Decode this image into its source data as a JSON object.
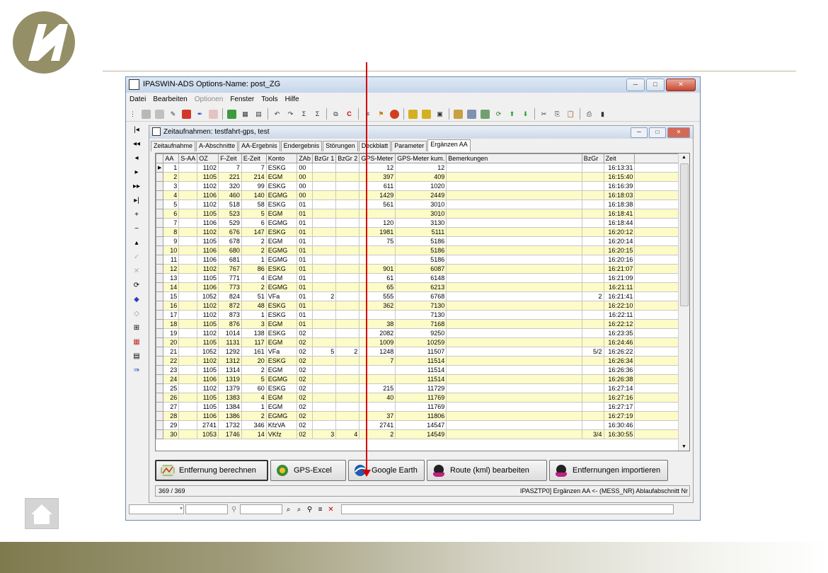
{
  "slide": {
    "logo_name": "company-logo",
    "home_icon": "home-icon"
  },
  "app": {
    "title": "IPASWIN-ADS  Options-Name: post_ZG",
    "menu": [
      "Datei",
      "Bearbeiten",
      "Optionen",
      "Fenster",
      "Tools",
      "Hilfe"
    ],
    "window_buttons": [
      "─",
      "□",
      "✕"
    ]
  },
  "doc": {
    "title": "Zeitaufnahmen: testfahrt-gps, test",
    "tabs": [
      "Zeitaufnahme",
      "A-Abschnitte",
      "AA-Ergebnis",
      "Endergebnis",
      "Störungen",
      "Deckblatt",
      "Parameter",
      "Ergänzen AA"
    ],
    "columns": [
      "AA",
      "S-AA",
      "OZ",
      "F-Zeit",
      "E-Zeit",
      "Konto",
      "ZAb",
      "BzGr 1",
      "BzGr 2",
      "GPS-Meter",
      "GPS-Meter kum.",
      "Bemerkungen",
      "BzGr",
      "Zeit"
    ],
    "rows": [
      [
        "1",
        "",
        "1102",
        "7",
        "7",
        "ESKG",
        "00",
        "",
        "",
        "12",
        "12",
        "",
        "",
        "16:13:31"
      ],
      [
        "2",
        "",
        "1105",
        "221",
        "214",
        "EGM",
        "00",
        "",
        "",
        "397",
        "409",
        "",
        "",
        "16:15:40"
      ],
      [
        "3",
        "",
        "1102",
        "320",
        "99",
        "ESKG",
        "00",
        "",
        "",
        "611",
        "1020",
        "",
        "",
        "16:16:39"
      ],
      [
        "4",
        "",
        "1106",
        "460",
        "140",
        "EGMG",
        "00",
        "",
        "",
        "1429",
        "2449",
        "",
        "",
        "16:18:03"
      ],
      [
        "5",
        "",
        "1102",
        "518",
        "58",
        "ESKG",
        "01",
        "",
        "",
        "561",
        "3010",
        "",
        "",
        "16:18:38"
      ],
      [
        "6",
        "",
        "1105",
        "523",
        "5",
        "EGM",
        "01",
        "",
        "",
        "",
        "3010",
        "",
        "",
        "16:18:41"
      ],
      [
        "7",
        "",
        "1106",
        "529",
        "6",
        "EGMG",
        "01",
        "",
        "",
        "120",
        "3130",
        "",
        "",
        "16:18:44"
      ],
      [
        "8",
        "",
        "1102",
        "676",
        "147",
        "ESKG",
        "01",
        "",
        "",
        "1981",
        "5111",
        "",
        "",
        "16:20:12"
      ],
      [
        "9",
        "",
        "1105",
        "678",
        "2",
        "EGM",
        "01",
        "",
        "",
        "75",
        "5186",
        "",
        "",
        "16:20:14"
      ],
      [
        "10",
        "",
        "1106",
        "680",
        "2",
        "EGMG",
        "01",
        "",
        "",
        "",
        "5186",
        "",
        "",
        "16:20:15"
      ],
      [
        "11",
        "",
        "1106",
        "681",
        "1",
        "EGMG",
        "01",
        "",
        "",
        "",
        "5186",
        "",
        "",
        "16:20:16"
      ],
      [
        "12",
        "",
        "1102",
        "767",
        "86",
        "ESKG",
        "01",
        "",
        "",
        "901",
        "6087",
        "",
        "",
        "16:21:07"
      ],
      [
        "13",
        "",
        "1105",
        "771",
        "4",
        "EGM",
        "01",
        "",
        "",
        "61",
        "6148",
        "",
        "",
        "16:21:09"
      ],
      [
        "14",
        "",
        "1106",
        "773",
        "2",
        "EGMG",
        "01",
        "",
        "",
        "65",
        "6213",
        "",
        "",
        "16:21:11"
      ],
      [
        "15",
        "",
        "1052",
        "824",
        "51",
        "VFa",
        "01",
        "2",
        "",
        "555",
        "6768",
        "",
        "2",
        "16:21:41"
      ],
      [
        "16",
        "",
        "1102",
        "872",
        "48",
        "ESKG",
        "01",
        "",
        "",
        "362",
        "7130",
        "",
        "",
        "16:22:10"
      ],
      [
        "17",
        "",
        "1102",
        "873",
        "1",
        "ESKG",
        "01",
        "",
        "",
        "",
        "7130",
        "",
        "",
        "16:22:11"
      ],
      [
        "18",
        "",
        "1105",
        "876",
        "3",
        "EGM",
        "01",
        "",
        "",
        "38",
        "7168",
        "",
        "",
        "16:22:12"
      ],
      [
        "19",
        "",
        "1102",
        "1014",
        "138",
        "ESKG",
        "02",
        "",
        "",
        "2082",
        "9250",
        "",
        "",
        "16:23:35"
      ],
      [
        "20",
        "",
        "1105",
        "1131",
        "117",
        "EGM",
        "02",
        "",
        "",
        "1009",
        "10259",
        "",
        "",
        "16:24:46"
      ],
      [
        "21",
        "",
        "1052",
        "1292",
        "161",
        "VFa",
        "02",
        "5",
        "2",
        "1248",
        "11507",
        "",
        "5/2",
        "16:26:22"
      ],
      [
        "22",
        "",
        "1102",
        "1312",
        "20",
        "ESKG",
        "02",
        "",
        "",
        "7",
        "11514",
        "",
        "",
        "16:26:34"
      ],
      [
        "23",
        "",
        "1105",
        "1314",
        "2",
        "EGM",
        "02",
        "",
        "",
        "",
        "11514",
        "",
        "",
        "16:26:36"
      ],
      [
        "24",
        "",
        "1106",
        "1319",
        "5",
        "EGMG",
        "02",
        "",
        "",
        "",
        "11514",
        "",
        "",
        "16:26:38"
      ],
      [
        "25",
        "",
        "1102",
        "1379",
        "60",
        "ESKG",
        "02",
        "",
        "",
        "215",
        "11729",
        "",
        "",
        "16:27:14"
      ],
      [
        "26",
        "",
        "1105",
        "1383",
        "4",
        "EGM",
        "02",
        "",
        "",
        "40",
        "11769",
        "",
        "",
        "16:27:16"
      ],
      [
        "27",
        "",
        "1105",
        "1384",
        "1",
        "EGM",
        "02",
        "",
        "",
        "",
        "11769",
        "",
        "",
        "16:27:17"
      ],
      [
        "28",
        "",
        "1106",
        "1386",
        "2",
        "EGMG",
        "02",
        "",
        "",
        "37",
        "11806",
        "",
        "",
        "16:27:19"
      ],
      [
        "29",
        "",
        "2741",
        "1732",
        "346",
        "KfzVA",
        "02",
        "",
        "",
        "2741",
        "14547",
        "",
        "",
        "16:30:46"
      ],
      [
        "30",
        "",
        "1053",
        "1746",
        "14",
        "VKfz",
        "02",
        "3",
        "4",
        "2",
        "14549",
        "",
        "3/4",
        "16:30:55"
      ]
    ],
    "buttons": [
      "Entfernung berechnen",
      "GPS-Excel",
      "Google Earth",
      "Route (kml) bearbeiten",
      "Entfernungen importieren"
    ],
    "status_left": "369 / 369",
    "status_right": "IPASZTP0] Ergänzen AA <- (MESS_NR) Ablaufabschnitt Nr"
  },
  "colors": {
    "row_highlight": "#fdfbc7",
    "arrow": "#d60000",
    "band_dark": "#7f7a4e"
  }
}
